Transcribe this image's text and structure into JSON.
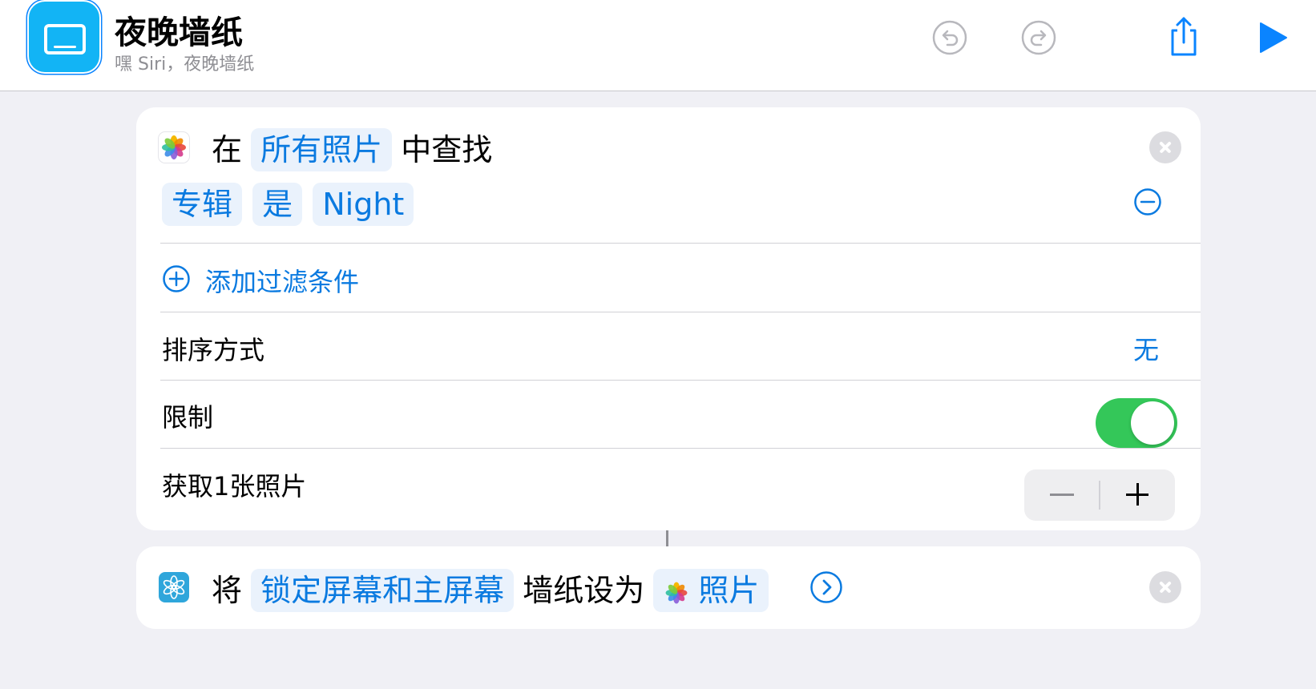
{
  "header": {
    "title": "夜晚墙纸",
    "subtitle": "嘿 Siri，夜晚墙纸"
  },
  "find_action": {
    "prefix": "在",
    "source_token": "所有照片",
    "suffix": "中查找",
    "filter": {
      "field": "专辑",
      "operator": "是",
      "value": "Night"
    },
    "add_filter_label": "添加过滤条件",
    "sort_label": "排序方式",
    "sort_value": "无",
    "limit_label": "限制",
    "limit_enabled": true,
    "count_label": "获取1张照片"
  },
  "wallpaper_action": {
    "prefix": "将",
    "target_token": "锁定屏幕和主屏幕",
    "middle": "墙纸设为",
    "photo_token": "照片"
  },
  "colors": {
    "accent": "#0A7AE0",
    "toggle_on": "#34C759",
    "background": "#F0F0F5",
    "app_icon": "#12B4F5"
  },
  "icons": {
    "undo": "undo-icon",
    "redo": "redo-icon",
    "share": "share-icon",
    "run": "play-icon",
    "photos": "photos-icon",
    "wallpaper": "wallpaper-icon"
  }
}
